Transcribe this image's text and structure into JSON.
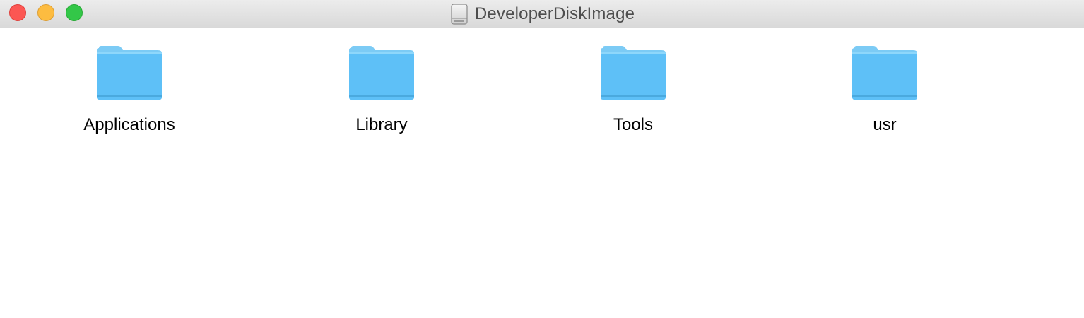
{
  "window": {
    "title": "DeveloperDiskImage",
    "title_icon": "disk-image-icon",
    "controls": [
      "close",
      "minimize",
      "zoom"
    ]
  },
  "items": [
    {
      "name": "Applications",
      "icon": "folder-icon"
    },
    {
      "name": "Library",
      "icon": "folder-icon"
    },
    {
      "name": "Tools",
      "icon": "folder-icon"
    },
    {
      "name": "usr",
      "icon": "folder-icon"
    }
  ],
  "colors": {
    "folder": "#5ec0f7",
    "folder_tab": "#7ccbf5",
    "close": "#fc5753",
    "minimize": "#fdbc40",
    "zoom": "#33c748"
  }
}
